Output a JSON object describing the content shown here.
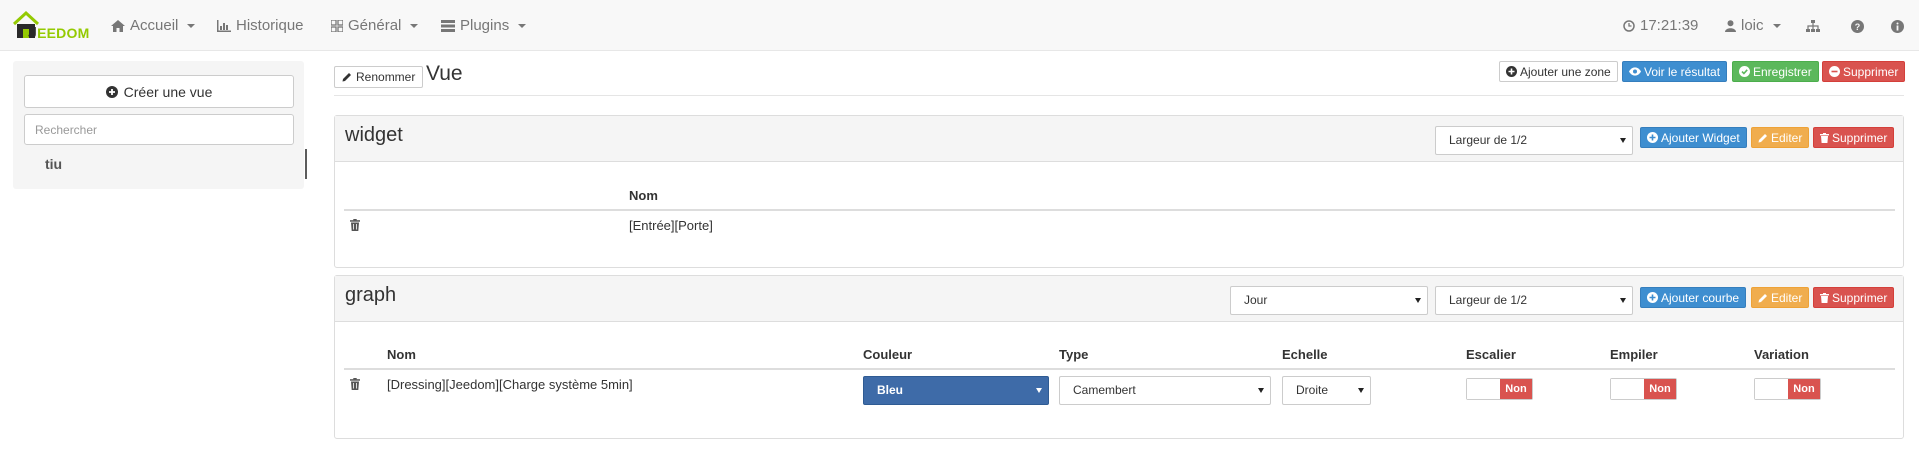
{
  "navbar": {
    "logo_letter": "J",
    "logo_rest": "EEDOM",
    "items": [
      {
        "label": "Accueil",
        "icon": "home-icon",
        "dropdown": true
      },
      {
        "label": "Historique",
        "icon": "bar-chart-icon",
        "dropdown": false
      },
      {
        "label": "Général",
        "icon": "grid-icon",
        "dropdown": true
      },
      {
        "label": "Plugins",
        "icon": "list-icon",
        "dropdown": true
      }
    ],
    "time": "17:21:39",
    "user": "loic",
    "icons": [
      "clock-icon",
      "user-icon",
      "sitemap-icon",
      "help-icon",
      "info-icon"
    ]
  },
  "sidebar": {
    "create_label": "Créer une vue",
    "search_placeholder": "Rechercher",
    "views": [
      "tiu"
    ]
  },
  "header": {
    "rename_label": "Renommer",
    "view_name": "Vue",
    "add_zone_label": "Ajouter une zone",
    "see_result_label": "Voir le résultat",
    "save_label": "Enregistrer",
    "delete_label": "Supprimer"
  },
  "zones": [
    {
      "title": "widget",
      "width_select": "Largeur de 1/2",
      "add_label": "Ajouter Widget",
      "edit_label": "Editer",
      "delete_label": "Supprimer",
      "columns": [
        "Nom"
      ],
      "rows": [
        {
          "name": "[Entrée][Porte]"
        }
      ]
    },
    {
      "title": "graph",
      "period_select": "Jour",
      "width_select": "Largeur de 1/2",
      "add_label": "Ajouter courbe",
      "edit_label": "Editer",
      "delete_label": "Supprimer",
      "columns": [
        "Nom",
        "Couleur",
        "Type",
        "Echelle",
        "Escalier",
        "Empiler",
        "Variation"
      ],
      "rows": [
        {
          "name": "[Dressing][Jeedom][Charge système 5min]",
          "color": "Bleu",
          "type": "Camembert",
          "scale": "Droite",
          "stair": "Non",
          "stack": "Non",
          "variation": "Non"
        }
      ]
    }
  ],
  "colors": {
    "primary": "#3e8ed0",
    "success": "#5cb85c",
    "danger": "#d9534f",
    "warning": "#f0ad4e",
    "series_blue": "#3e6ba8",
    "logo_green": "#94ca02"
  }
}
